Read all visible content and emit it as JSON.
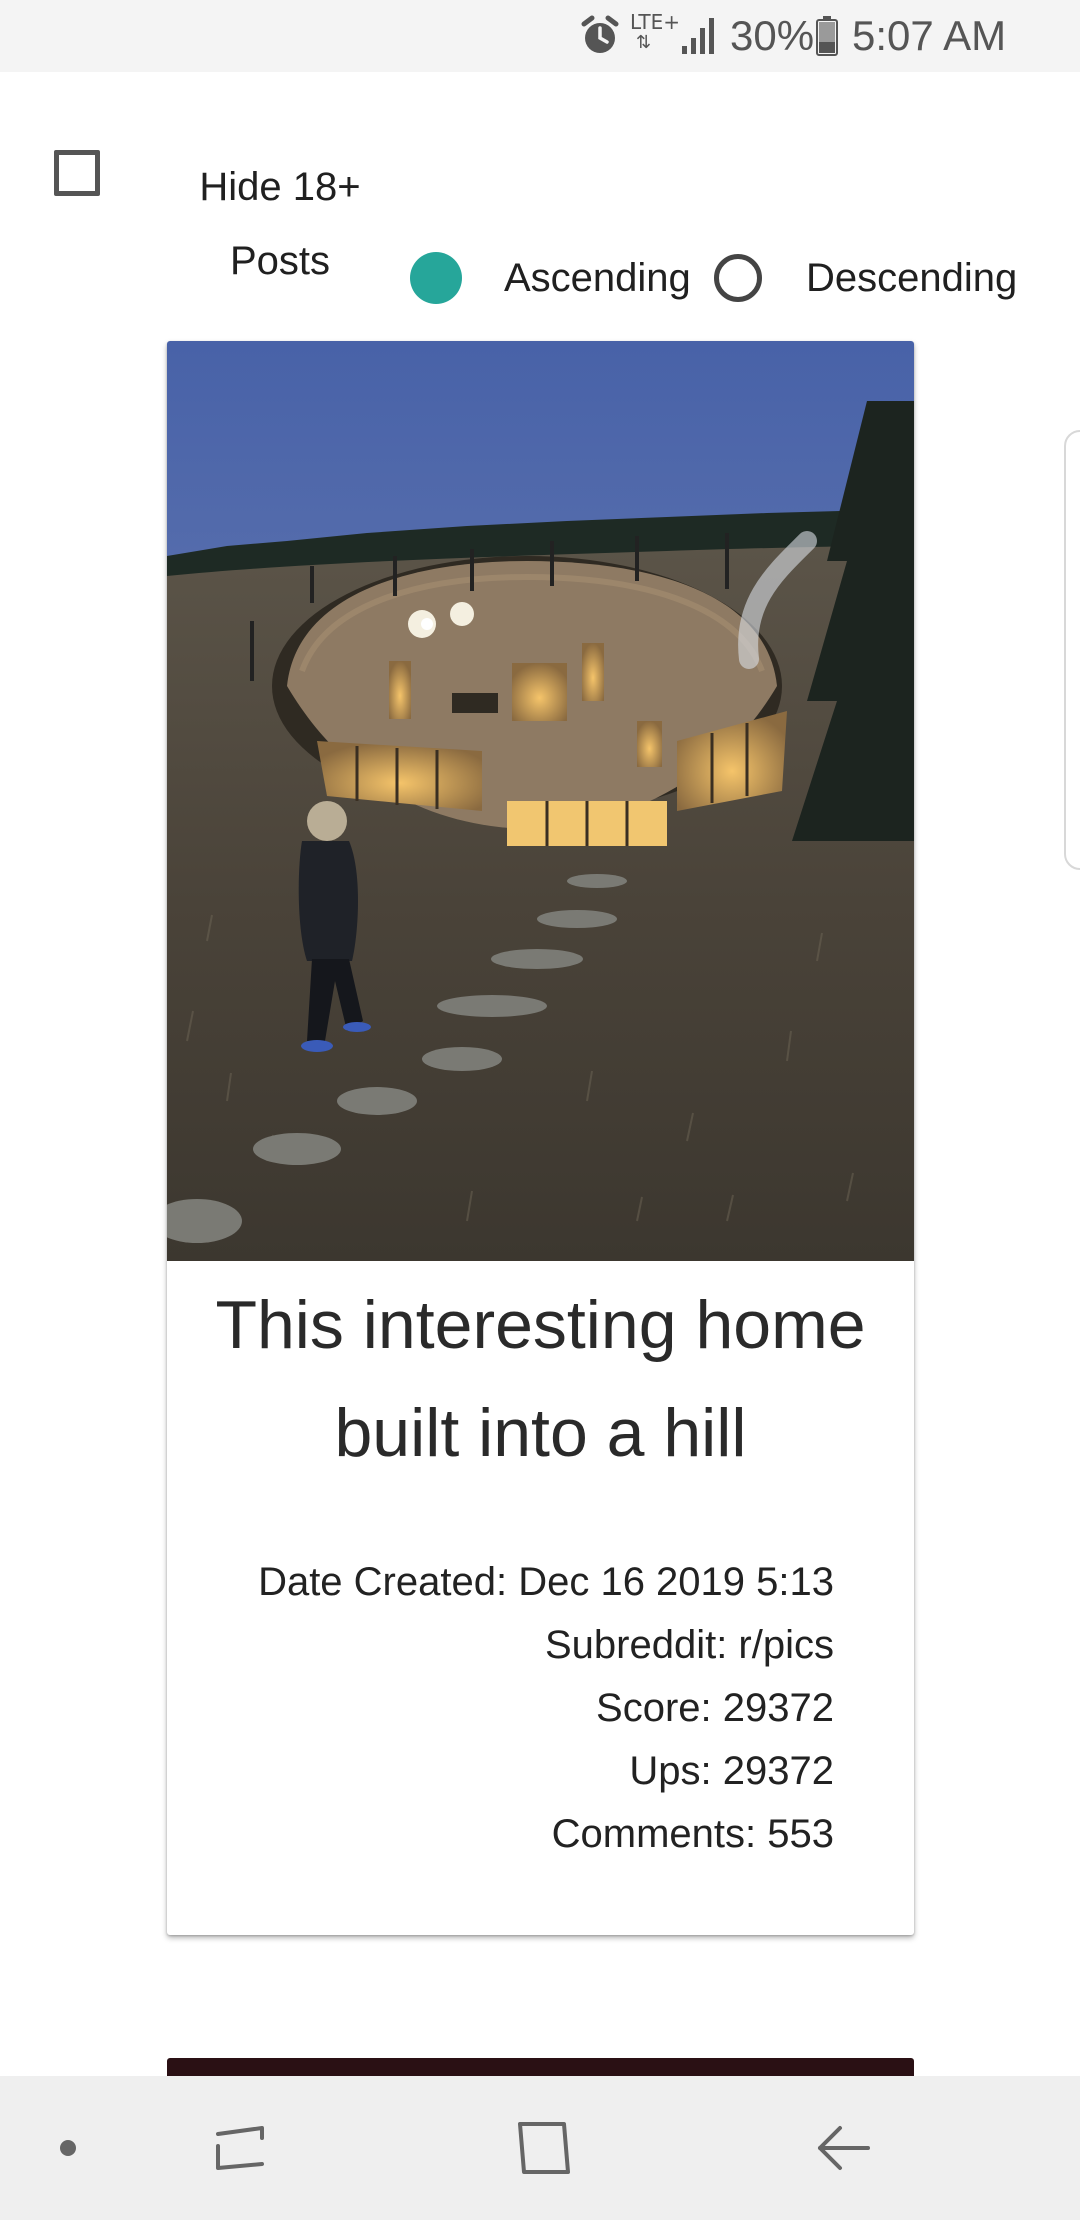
{
  "status_bar": {
    "network": "LTE+",
    "network_arrows": "⇅",
    "battery": "30%",
    "time": "5:07 AM",
    "icons": [
      "alarm-icon",
      "signal-icon",
      "battery-icon"
    ]
  },
  "controls": {
    "hide_nsfw_label": "Hide 18+ Posts",
    "hide_nsfw_checked": false,
    "sort_ascending_label": "Ascending",
    "sort_descending_label": "Descending",
    "sort_selected": "Ascending",
    "accent_color": "#26a69a"
  },
  "posts": [
    {
      "title": "This interesting home built into a hill",
      "date_created": "Date Created: Dec 16 2019 5:13",
      "subreddit": "Subreddit: r/pics",
      "score": "Score: 29372",
      "ups": "Ups: 29372",
      "comments": "Comments: 553"
    }
  ],
  "nav_bar": {
    "icons": [
      "dot-icon",
      "recent-apps-icon",
      "home-icon",
      "back-icon"
    ]
  }
}
